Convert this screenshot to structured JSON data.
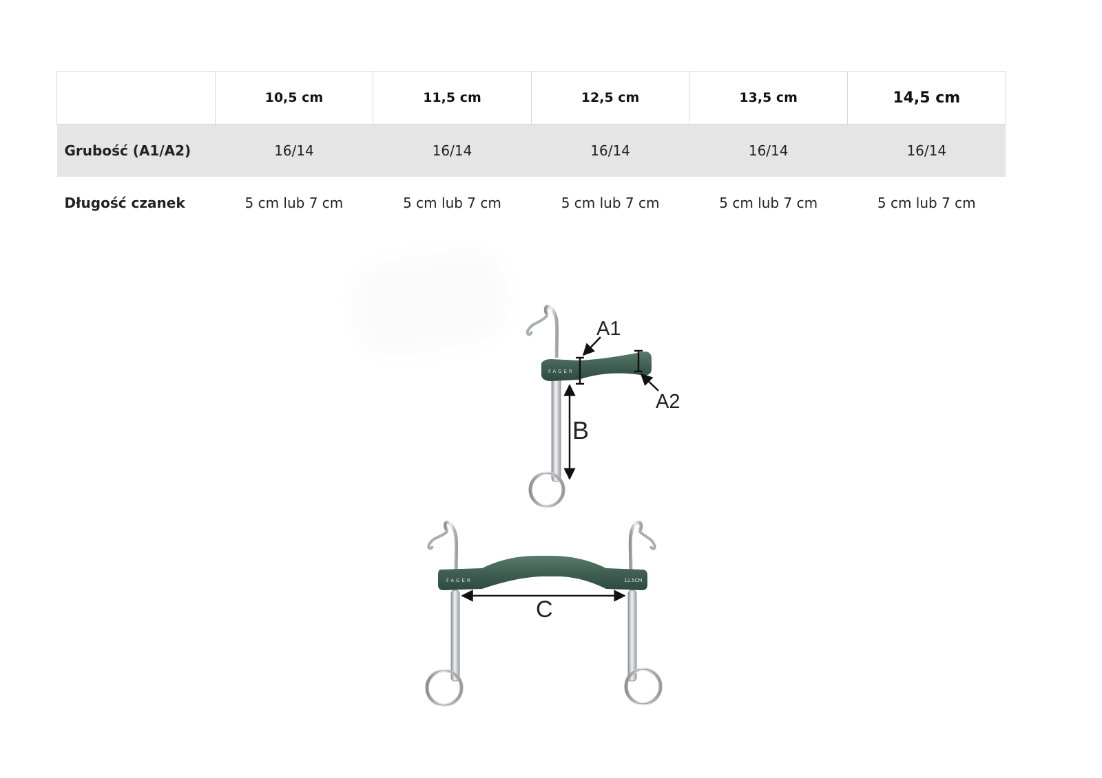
{
  "table": {
    "header": [
      "",
      "10,5 cm",
      "11,5 cm",
      "12,5 cm",
      "13,5 cm",
      "14,5 cm"
    ],
    "rows": [
      {
        "label": "Grubość (A1/A2)",
        "cells": [
          "16/14",
          "16/14",
          "16/14",
          "16/14",
          "16/14"
        ]
      },
      {
        "label": "Długość czanek",
        "cells": [
          "5 cm lub 7 cm",
          "5 cm lub 7 cm",
          "5 cm lub 7 cm",
          "5 cm lub 7 cm",
          "5 cm lub 7 cm"
        ]
      }
    ]
  },
  "diagram": {
    "labels": {
      "a1": "A1",
      "a2": "A2",
      "b": "B",
      "c": "C"
    },
    "brand_text": "FAGER",
    "size_text": "12.5CM",
    "colors": {
      "mouthpiece": "#3f5f52",
      "steel": "#b8bcc0",
      "arrow": "#111111"
    }
  }
}
